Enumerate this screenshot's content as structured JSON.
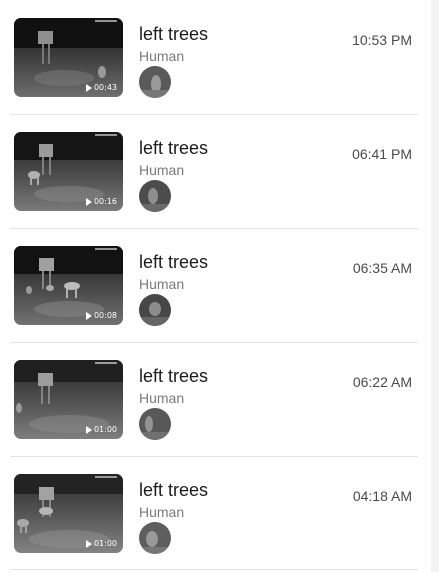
{
  "events": [
    {
      "title": "left trees",
      "type": "Human",
      "time": "10:53 PM",
      "duration": "00:43"
    },
    {
      "title": "left trees",
      "type": "Human",
      "time": "06:41 PM",
      "duration": "00:16"
    },
    {
      "title": "left trees",
      "type": "Human",
      "time": "06:35 AM",
      "duration": "00:08"
    },
    {
      "title": "left trees",
      "type": "Human",
      "time": "06:22 AM",
      "duration": "01:00"
    },
    {
      "title": "left trees",
      "type": "Human",
      "time": "04:18 AM",
      "duration": "01:00"
    }
  ],
  "icons": {
    "play": "play-icon",
    "thumbnail": "night-vision-thumbnail",
    "avatar": "detected-face-avatar"
  }
}
